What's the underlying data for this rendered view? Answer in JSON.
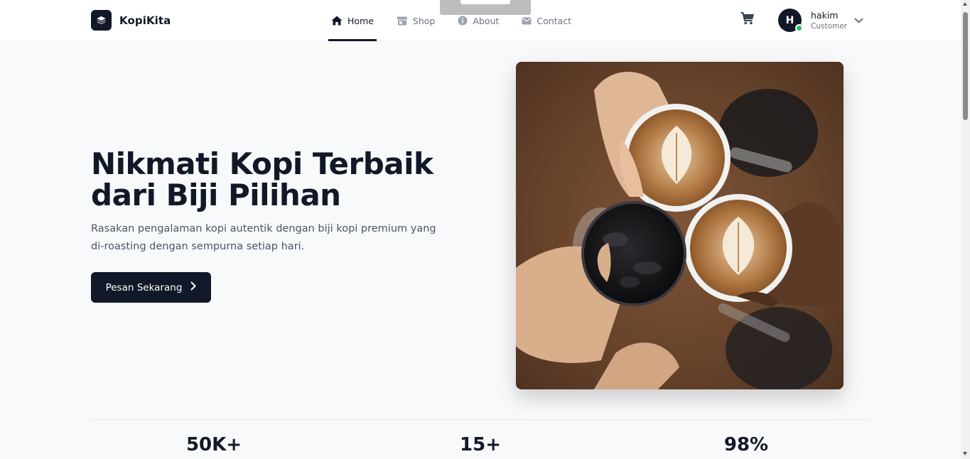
{
  "brand": {
    "name": "KopiKita",
    "logo_icon": "layers-icon"
  },
  "nav": {
    "items": [
      {
        "label": "Home",
        "icon": "home-icon",
        "active": true
      },
      {
        "label": "Shop",
        "icon": "store-icon",
        "active": false
      },
      {
        "label": "About",
        "icon": "info-icon",
        "active": false
      },
      {
        "label": "Contact",
        "icon": "envelope-icon",
        "active": false
      }
    ]
  },
  "header": {
    "cart_icon": "cart-icon",
    "user": {
      "initial": "H",
      "name": "hakim",
      "role": "Customer",
      "status_color": "#22c55e"
    }
  },
  "hero": {
    "title_line1": "Nikmati Kopi Terbaik",
    "title_line2": "dari Biji Pilihan",
    "subtitle": "Rasakan pengalaman kopi autentik dengan biji kopi premium yang di-roasting dengan sempurna setiap hari.",
    "cta_label": "Pesan Sekarang",
    "image": "coffee-cheers-photo"
  },
  "stats": [
    {
      "value": "50K+"
    },
    {
      "value": "15+"
    },
    {
      "value": "98%"
    }
  ],
  "colors": {
    "primary": "#111827",
    "background": "#f8f9fb",
    "muted": "#6b7280"
  }
}
